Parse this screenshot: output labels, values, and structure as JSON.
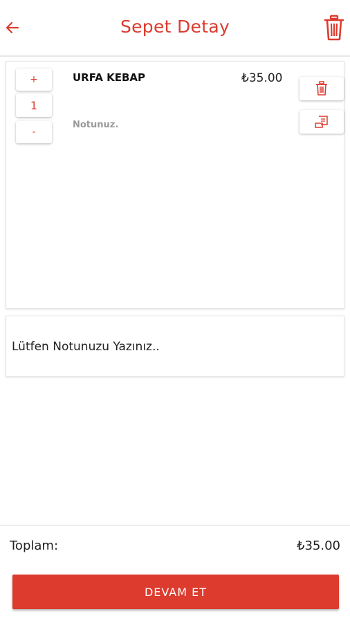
{
  "header": {
    "title": "Sepet Detay",
    "back_icon": "arrow-left-icon",
    "clear_icon": "trash-icon"
  },
  "cart": {
    "items": [
      {
        "name": "URFA KEBAP",
        "price": "₺35.00",
        "quantity": "1",
        "note_label": "Notunuz.",
        "increment_label": "+",
        "decrement_label": "-",
        "delete_icon": "trash-icon",
        "note_icon": "note-edit-icon"
      }
    ]
  },
  "note": {
    "placeholder": "Lütfen Notunuzu Yazınız.."
  },
  "footer": {
    "total_label": "Toplam:",
    "total_value": "₺35.00",
    "continue_label": "DEVAM ET"
  },
  "colors": {
    "accent": "#dc3b2e",
    "background": "#ffffff"
  }
}
